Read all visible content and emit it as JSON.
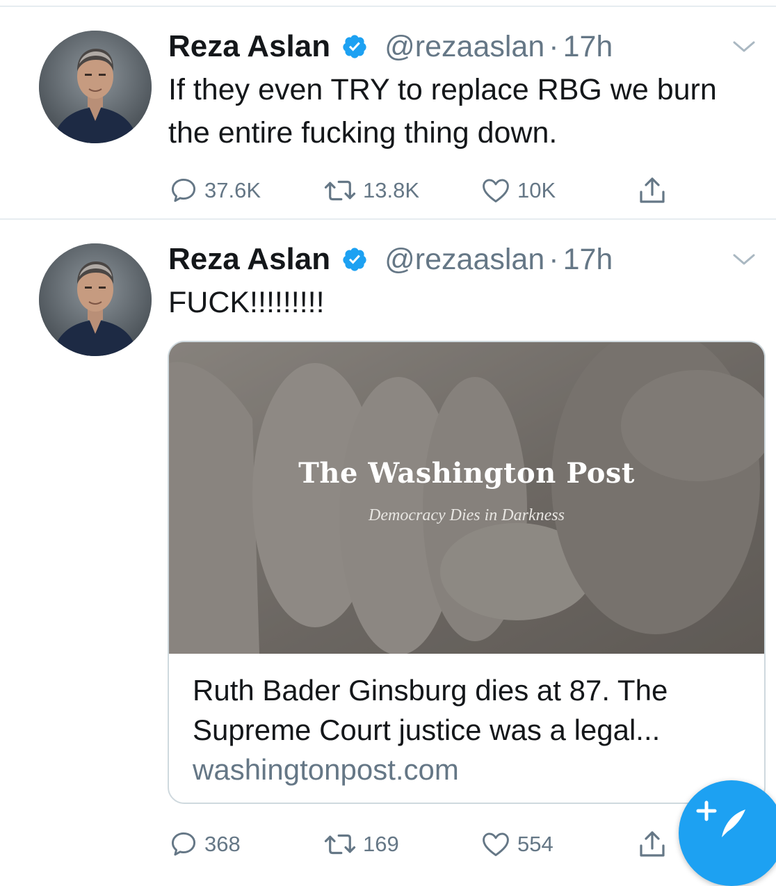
{
  "tweets": [
    {
      "name": "Reza Aslan",
      "handle": "@rezaaslan",
      "dot": "·",
      "time": "17h",
      "text": "If they even TRY to replace RBG we burn the entire fucking thing down.",
      "replies": "37.6K",
      "retweets": "13.8K",
      "likes": "10K"
    },
    {
      "name": "Reza Aslan",
      "handle": "@rezaaslan",
      "dot": "·",
      "time": "17h",
      "text": "FUCK!!!!!!!!!",
      "card": {
        "brand": "The Washington Post",
        "tagline": "Democracy Dies in Darkness",
        "title": "Ruth Bader Ginsburg dies at 87. The Supreme Court justice was a legal...",
        "domain": "washingtonpost.com"
      },
      "replies": "368",
      "retweets": "169",
      "likes": "554"
    }
  ],
  "icons": {
    "verified": "verified-badge-icon",
    "more": "chevron-down-icon",
    "reply": "reply-icon",
    "retweet": "retweet-icon",
    "like": "heart-icon",
    "share": "share-icon",
    "compose": "compose-tweet-icon"
  },
  "colors": {
    "accent": "#1da1f2",
    "secondary_text": "#657786",
    "divider": "#e6ecf0"
  }
}
